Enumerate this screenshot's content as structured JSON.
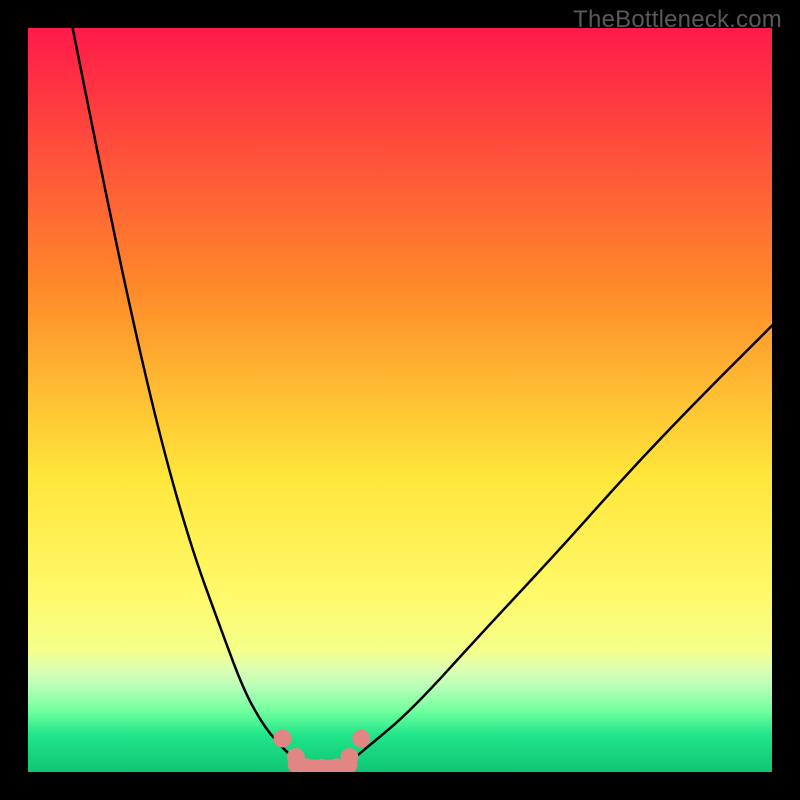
{
  "watermark": "TheBottleneck.com",
  "chart_data": {
    "type": "line",
    "title": "",
    "xlabel": "",
    "ylabel": "",
    "xlim": [
      0,
      100
    ],
    "ylim": [
      0,
      100
    ],
    "grid": false,
    "legend": false,
    "gradient_stops": [
      {
        "offset": 0,
        "color": "#ff1a4a"
      },
      {
        "offset": 0.35,
        "color": "#ff8a2a"
      },
      {
        "offset": 0.6,
        "color": "#ffe63a"
      },
      {
        "offset": 0.76,
        "color": "#fff96a"
      },
      {
        "offset": 0.835,
        "color": "#f6ff8a"
      },
      {
        "offset": 0.86,
        "color": "#deffb0"
      },
      {
        "offset": 0.885,
        "color": "#b9ffb9"
      },
      {
        "offset": 0.92,
        "color": "#6cff9e"
      },
      {
        "offset": 0.95,
        "color": "#21e58a"
      },
      {
        "offset": 1.0,
        "color": "#0fc573"
      }
    ],
    "series": [
      {
        "name": "left-curve",
        "color": "#000000",
        "x": [
          6,
          10,
          14,
          18,
          22,
          26,
          29,
          31.5,
          33.5,
          35.2,
          36.5
        ],
        "y": [
          100,
          80,
          61,
          44,
          30,
          19,
          11,
          6.5,
          4,
          2.3,
          1.2
        ]
      },
      {
        "name": "right-curve",
        "color": "#000000",
        "x": [
          43,
          44.5,
          47,
          50,
          54,
          59,
          65,
          72,
          80,
          89,
          100
        ],
        "y": [
          1.2,
          2.4,
          4.5,
          7.0,
          11.0,
          16.5,
          23.0,
          30.5,
          39.5,
          49.0,
          60.0
        ]
      }
    ],
    "bottom_markers": {
      "color": "#e28684",
      "left_cluster_x": [
        34.2,
        36.0
      ],
      "left_cluster_y": [
        4.5,
        2.0
      ],
      "right_cluster_x": [
        43.2,
        44.8
      ],
      "right_cluster_y": [
        2.0,
        4.5
      ],
      "flat_x": [
        36.0,
        37.5,
        39.5,
        41.5,
        43.2
      ],
      "flat_y": [
        0.9,
        0.75,
        0.7,
        0.75,
        0.9
      ]
    }
  }
}
